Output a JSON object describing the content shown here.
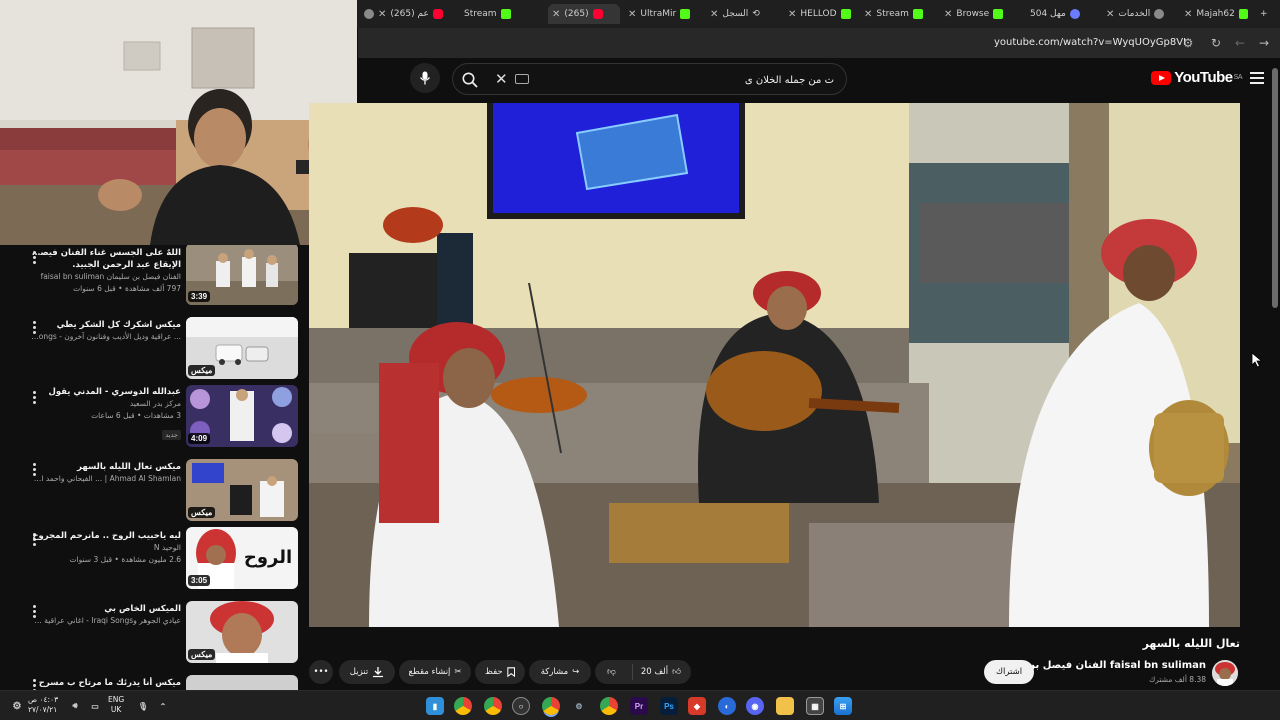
{
  "browser": {
    "tabs": [
      {
        "title": "(265) عم",
        "icon": "youtube-icon"
      },
      {
        "title": "Stream",
        "icon": "kick-icon"
      },
      {
        "title": "(265)",
        "icon": "youtube-icon"
      },
      {
        "title": "UltraMir",
        "icon": "kick-icon"
      },
      {
        "title": "السجل",
        "icon": "history-icon"
      },
      {
        "title": "HELLOD",
        "icon": "kick-icon"
      },
      {
        "title": "Stream",
        "icon": "kick-icon"
      },
      {
        "title": "Browse",
        "icon": "kick-icon"
      },
      {
        "title": "504 مهل",
        "icon": "site-icon"
      },
      {
        "title": "الخدمات",
        "icon": "site-icon"
      },
      {
        "title": "Majah62",
        "icon": "kick-icon"
      }
    ],
    "url": "youtube.com/watch?v=WyqUOyGp8VI"
  },
  "youtube": {
    "search_value": "ت من جمله الخلان ى",
    "logo_text": "YouTube",
    "logo_region": "SA",
    "video_title": "تعال الليله بالسهر",
    "channel": {
      "name": "faisal bn suliman",
      "name_ar": "الفنان فيصل بن سليمان",
      "subscribers": "8.38 ألف مشترك",
      "subscribe_label": "اشتراك"
    },
    "actions": {
      "like_count": "20 ألف",
      "share_label": "مشاركة",
      "save_label": "حفظ",
      "clip_label": "إنشاء مقطع",
      "download_label": "تنزيل"
    },
    "recommendations": [
      {
        "title": "اللهٌ على الجسس غناء الفنان فيصل بن سليمان",
        "subtitle": "الإيقاع عبد الرحمن الجبيد.",
        "channel": "الفنان فيصل بن سليمان faisal bn suliman",
        "meta": "797 ألف مشاهدة • قبل 6 سنوات",
        "duration": "3:39"
      },
      {
        "title": "ميكس اشكرك كل الشكر يطي",
        "subtitle": "",
        "channel": "... عراقية وديل الأديب وفنانون آخرون - Iraqi Songs",
        "meta": "",
        "duration": "ميكس"
      },
      {
        "title": "عبدالله الدوسري - المدني يقول",
        "subtitle": "",
        "channel": "مركز بدر السعيد",
        "meta": "3 مشاهدات • قبل 6 ساعات",
        "duration": "4:09",
        "badge": "جديد"
      },
      {
        "title": "ميكس تعال الليله بالسهر",
        "subtitle": "",
        "channel": "Ahmad Al Shamlan | ... الفيحاني واحمد ال شملان",
        "meta": "",
        "duration": "ميكس"
      },
      {
        "title": "ليه ياحبيب الروح .. مانرحم المجروح",
        "subtitle": "",
        "channel": "الوحيد N",
        "meta": "2.6 مليون مشاهدة • قبل 3 سنوات",
        "duration": "3:05"
      },
      {
        "title": "الميكس الخاص بي",
        "subtitle": "",
        "channel": "عيادي الجوهر وIraqi Songs - اغاني عراقية وغاك حلـ...",
        "meta": "",
        "duration": "ميكس"
      },
      {
        "title": "ميكس أنا يدرئك ما مرتاح ب مسرح",
        "subtitle": "",
        "channel": "",
        "meta": "",
        "duration": ""
      }
    ]
  },
  "taskbar": {
    "time": "٠٤:٠٣ ص",
    "date": "٢٧/٠٧/٢١",
    "lang_top": "ENG",
    "lang_bottom": "UK",
    "apps": [
      "file-explorer-icon",
      "chrome-icon",
      "chrome-icon",
      "obs-icon",
      "chrome-icon",
      "settings-icon",
      "chrome-icon",
      "premiere-icon",
      "photoshop-icon",
      "app-icon",
      "app-icon",
      "discord-icon",
      "folder-icon",
      "store-icon",
      "start-icon"
    ]
  },
  "colors": {
    "accent": "#ff0000",
    "background": "#0f0f0f",
    "pill": "#272727",
    "kick": "#53fc18"
  }
}
